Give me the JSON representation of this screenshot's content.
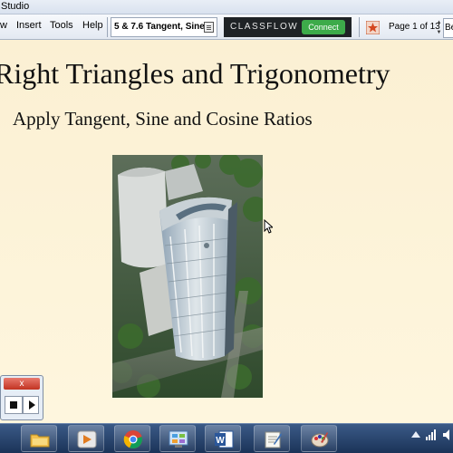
{
  "app": {
    "title_fragment": "Studio"
  },
  "menu": {
    "items": [
      "w",
      "Insert",
      "Tools",
      "Help"
    ]
  },
  "toolbar": {
    "doc_title": "5 & 7.6 Tangent, Sine",
    "classflow_brand": "CLASSFLOW",
    "classflow_connect": "Connect",
    "page_label": "Page 1 of 13",
    "truncated_button": "Be"
  },
  "slide": {
    "title": "Right Triangles and Trigonometry",
    "subtitle": "Apply Tangent, Sine and Cosine Ratios",
    "image": "building-photo"
  },
  "player": {
    "close_symbol": "x"
  },
  "taskbar": {
    "icons": [
      "file-explorer-icon",
      "media-player-icon",
      "chrome-icon",
      "control-panel-icon",
      "word-icon",
      "notepad-icon",
      "paint-icon"
    ]
  },
  "colors": {
    "slide_background": "#fbf0d2",
    "classflow_bar": "#1f2326",
    "connect_green": "#3dab4a",
    "taskbar": "#1b3358"
  }
}
